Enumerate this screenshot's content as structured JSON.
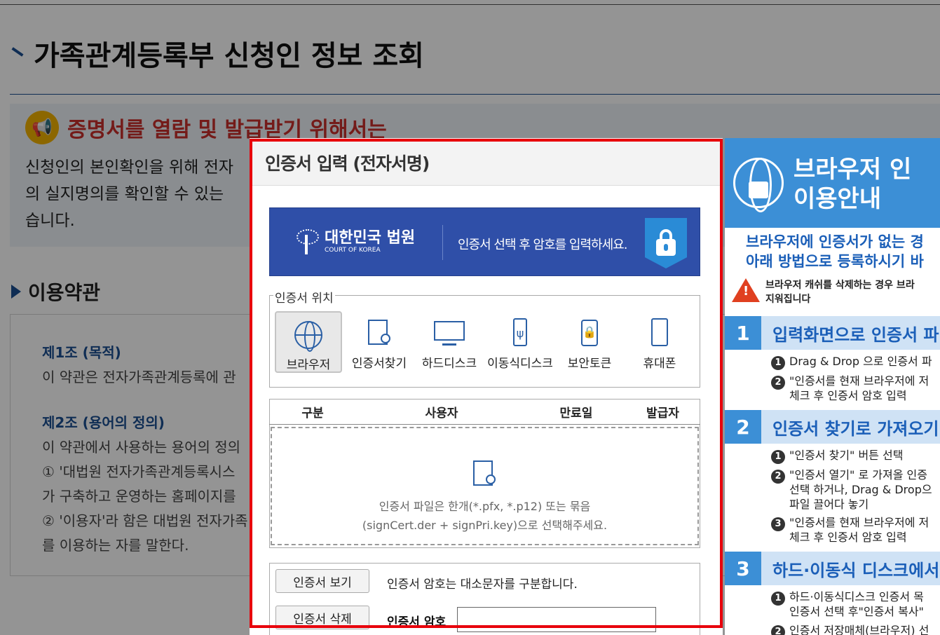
{
  "page": {
    "title": "가족관계등록부 신청인 정보 조회",
    "notice_title": "증명서를 열람 및 발급받기 위해서는",
    "notice_lines": [
      "신청인의 본인확인을 위해 전자",
      "의 실지명의를 확인할 수 있는 ",
      "습니다."
    ],
    "terms_section": "이용약관",
    "terms": {
      "art1_head": "제1조 (목적)",
      "art1_text": "이 약관은 전자가족관계등록에 관",
      "art2_head": "제2조 (용어의 정의)",
      "art2_l1": "이 약관에서 사용하는 용어의 정의",
      "art2_l2": "① '대법원 전자가족관계등록시스",
      "art2_l3": "가 구축하고 운영하는 홈페이지를",
      "art2_l4": "② '이용자'라 함은 대법원 전자가족",
      "art2_l5": "를 이용하는 자를 말한다."
    }
  },
  "modal": {
    "title": "인증서 입력 (전자서명)",
    "banner": {
      "logo_kr": "대한민국 법원",
      "logo_en": "COURT OF KOREA",
      "message": "인증서 선택 후 암호를 입력하세요."
    },
    "location_legend": "인증서 위치",
    "locations": [
      {
        "label": "브라우저",
        "icon": "globe-icon",
        "active": true
      },
      {
        "label": "인증서찾기",
        "icon": "certificate-search-icon"
      },
      {
        "label": "하드디스크",
        "icon": "monitor-icon"
      },
      {
        "label": "이동식디스크",
        "icon": "usb-icon"
      },
      {
        "label": "보안토큰",
        "icon": "security-token-icon"
      },
      {
        "label": "휴대폰",
        "icon": "phone-icon"
      }
    ],
    "table_headers": [
      "구분",
      "사용자",
      "만료일",
      "발급자"
    ],
    "drop_text_1": "인증서 파일은 한개(*.pfx, *.p12) 또는 묶음",
    "drop_text_2": "(signCert.der + signPri.key)으로 선택해주세요.",
    "view_button": "인증서 보기",
    "delete_button": "인증서 삭제",
    "password_note": "인증서 암호는 대소문자를 구분합니다.",
    "password_label": "인증서 암호",
    "password_value": ""
  },
  "guide": {
    "title_1": "브라우저 인",
    "title_2": "이용안내",
    "sub_1": "브라우저에 인증서가 없는 경",
    "sub_2": "아래 방법으로 등록하시기 바",
    "warn_1": "브라우저 캐쉬를 삭제하는 경우 브라",
    "warn_2": "지워집니다",
    "steps": [
      {
        "num": "1",
        "title": "입력화면으로 인증서 파"
      },
      {
        "num": "2",
        "title": "인증서 찾기로 가져오기"
      },
      {
        "num": "3",
        "title": "하드·이동식 디스크에서"
      }
    ],
    "s1_l1": "Drag & Drop 으로 인증서 파",
    "s1_l2": "\"인증서를 현재 브라우저에 저",
    "s1_l3": "체크 후 인증서 암호 입력",
    "s2_l1": "\"인증서 찾기\" 버튼 선택",
    "s2_l2": "\"인증서 열기\" 로 가져올 인증",
    "s2_l3": "선택 하거나, Drag & Drop으",
    "s2_l4": "파일 끌어다 놓기",
    "s2_l5": "\"인증서를 현재 브라우저에 저",
    "s2_l6": "체크 후 인증서 암호 입력",
    "s3_l1": "하드·이동식디스크 인증서 목",
    "s3_l2": "인증서 선택 후\"인증서 복사\"",
    "s3_l3": "인증서 저장매체(브라우저) 선"
  },
  "colors": {
    "accent": "#1b4f91",
    "banner": "#2f4fa8",
    "guide_blue": "#3c8fd6",
    "highlight_frame": "#e8000b"
  }
}
